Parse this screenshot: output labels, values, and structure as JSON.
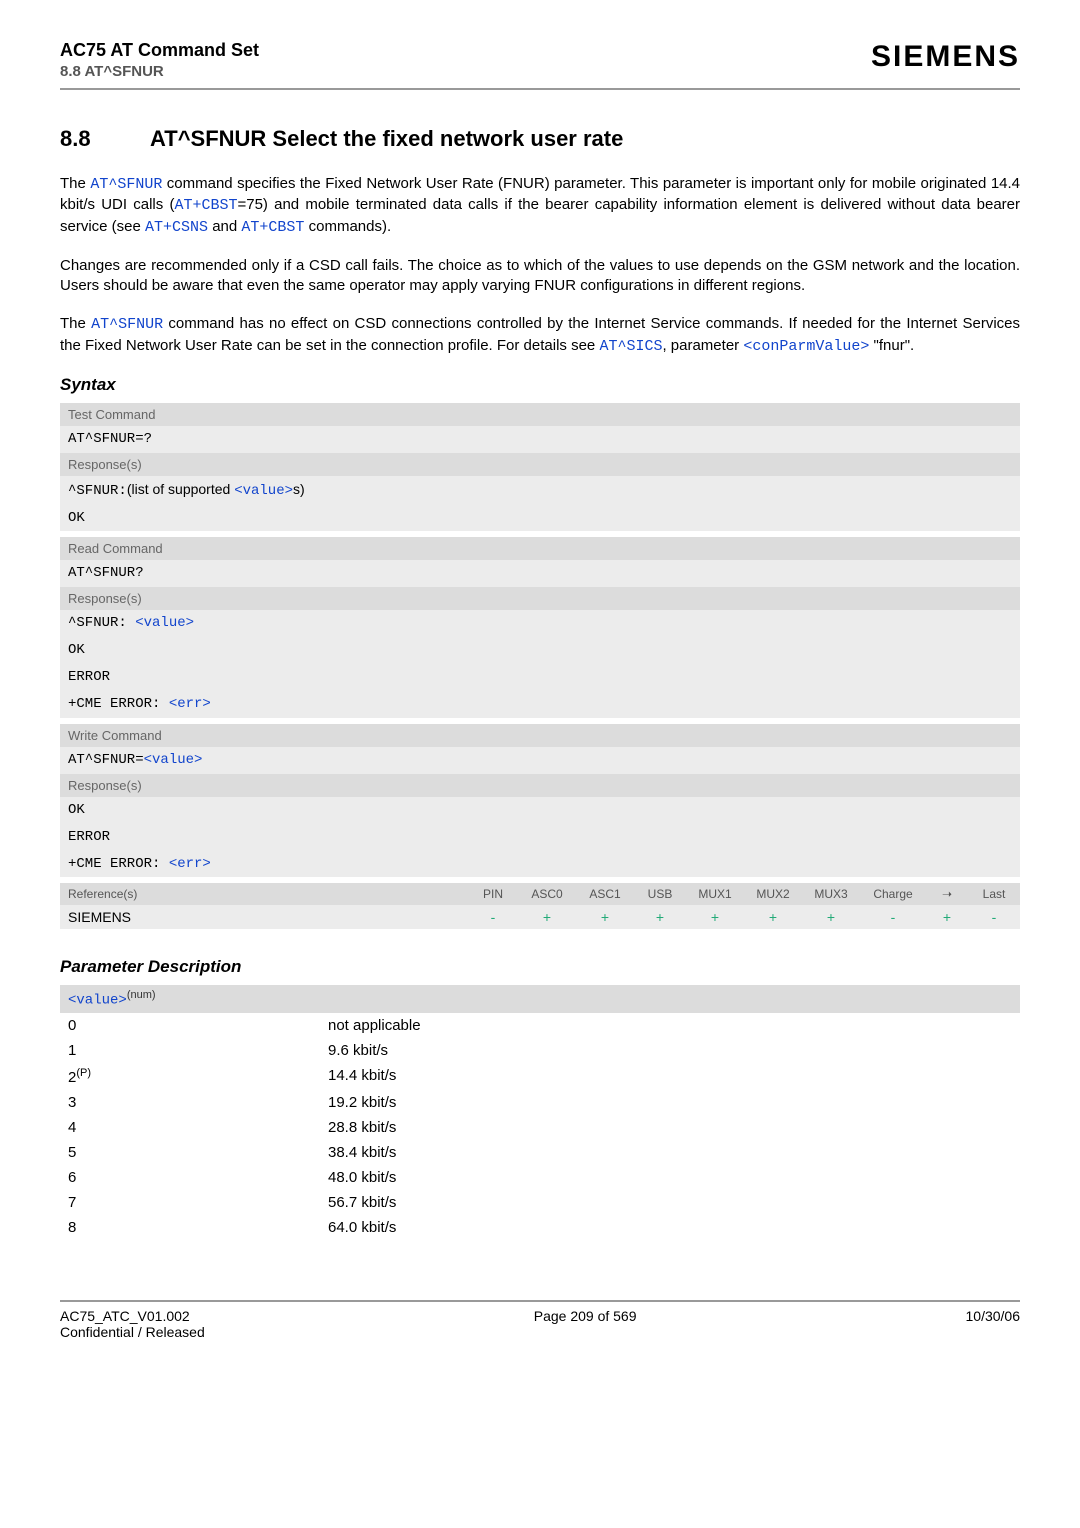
{
  "header": {
    "line1": "AC75 AT Command Set",
    "line2": "8.8 AT^SFNUR",
    "brand": "SIEMENS"
  },
  "title": {
    "num": "8.8",
    "text": "AT^SFNUR   Select the fixed network user rate"
  },
  "para1_a": "The ",
  "para1_cmd1": "AT^SFNUR",
  "para1_b": " command specifies the Fixed Network User Rate (FNUR) parameter. This parameter is important only for mobile originated 14.4 kbit/s UDI calls (",
  "para1_cmd2": "AT+CBST",
  "para1_c": "=75) and mobile terminated data calls if the bearer capability information element is delivered without data bearer service (see ",
  "para1_cmd3": "AT+CSNS",
  "para1_d": " and ",
  "para1_cmd4": "AT+CBST",
  "para1_e": " commands).",
  "para2": "Changes are recommended only if a CSD call fails. The choice as to which of the values to use depends on the GSM network and the location. Users should be aware that even the same operator may apply varying FNUR configurations in different regions.",
  "para3_a": "The ",
  "para3_cmd1": "AT^SFNUR",
  "para3_b": " command has no effect on CSD connections controlled by the Internet Service commands. If needed for the Internet Services the Fixed Network User Rate can be set in the connection profile. For details see ",
  "para3_cmd2": "AT^SICS",
  "para3_c": ", parameter ",
  "para3_cmd3": "<conParmValue>",
  "para3_d": " \"fnur\".",
  "syntax_label": "Syntax",
  "test": {
    "head": "Test Command",
    "cmd": "AT^SFNUR=?",
    "resp_head": "Response(s)",
    "resp1_pfx": "^SFNUR:",
    "resp1_mid": "(list of supported ",
    "resp1_val": "<value>",
    "resp1_sfx": "s)",
    "resp2": "OK"
  },
  "read": {
    "head": "Read Command",
    "cmd": "AT^SFNUR?",
    "resp_head": "Response(s)",
    "resp1_pfx": "^SFNUR: ",
    "resp1_val": "<value>",
    "resp2": "OK",
    "resp3": "ERROR",
    "resp4_pfx": "+CME ERROR: ",
    "resp4_val": "<err>"
  },
  "write": {
    "head": "Write Command",
    "cmd_pfx": "AT^SFNUR=",
    "cmd_val": "<value>",
    "resp_head": "Response(s)",
    "resp1": "OK",
    "resp2": "ERROR",
    "resp3_pfx": "+CME ERROR: ",
    "resp3_val": "<err>"
  },
  "refheader": {
    "first": "Reference(s)",
    "cols": [
      "PIN",
      "ASC0",
      "ASC1",
      "USB",
      "MUX1",
      "MUX2",
      "MUX3",
      "Charge",
      "➝",
      "Last"
    ]
  },
  "refdata": {
    "first": "SIEMENS",
    "tokens": [
      "-",
      "+",
      "+",
      "+",
      "+",
      "+",
      "+",
      "-",
      "+",
      "-"
    ]
  },
  "paramdesc_label": "Parameter Description",
  "param_head_val": "<value>",
  "param_head_sup": "(num)",
  "params": [
    {
      "k": "0",
      "v": "not applicable"
    },
    {
      "k": "1",
      "v": "9.6 kbit/s"
    },
    {
      "k_html": "2",
      "k_sup": "(P)",
      "v": "14.4 kbit/s"
    },
    {
      "k": "3",
      "v": "19.2 kbit/s"
    },
    {
      "k": "4",
      "v": "28.8 kbit/s"
    },
    {
      "k": "5",
      "v": "38.4 kbit/s"
    },
    {
      "k": "6",
      "v": "48.0 kbit/s"
    },
    {
      "k": "7",
      "v": "56.7 kbit/s"
    },
    {
      "k": "8",
      "v": "64.0 kbit/s"
    }
  ],
  "footer": {
    "left1": "AC75_ATC_V01.002",
    "left2": "Confidential / Released",
    "center": "Page 209 of 569",
    "right": "10/30/06"
  }
}
